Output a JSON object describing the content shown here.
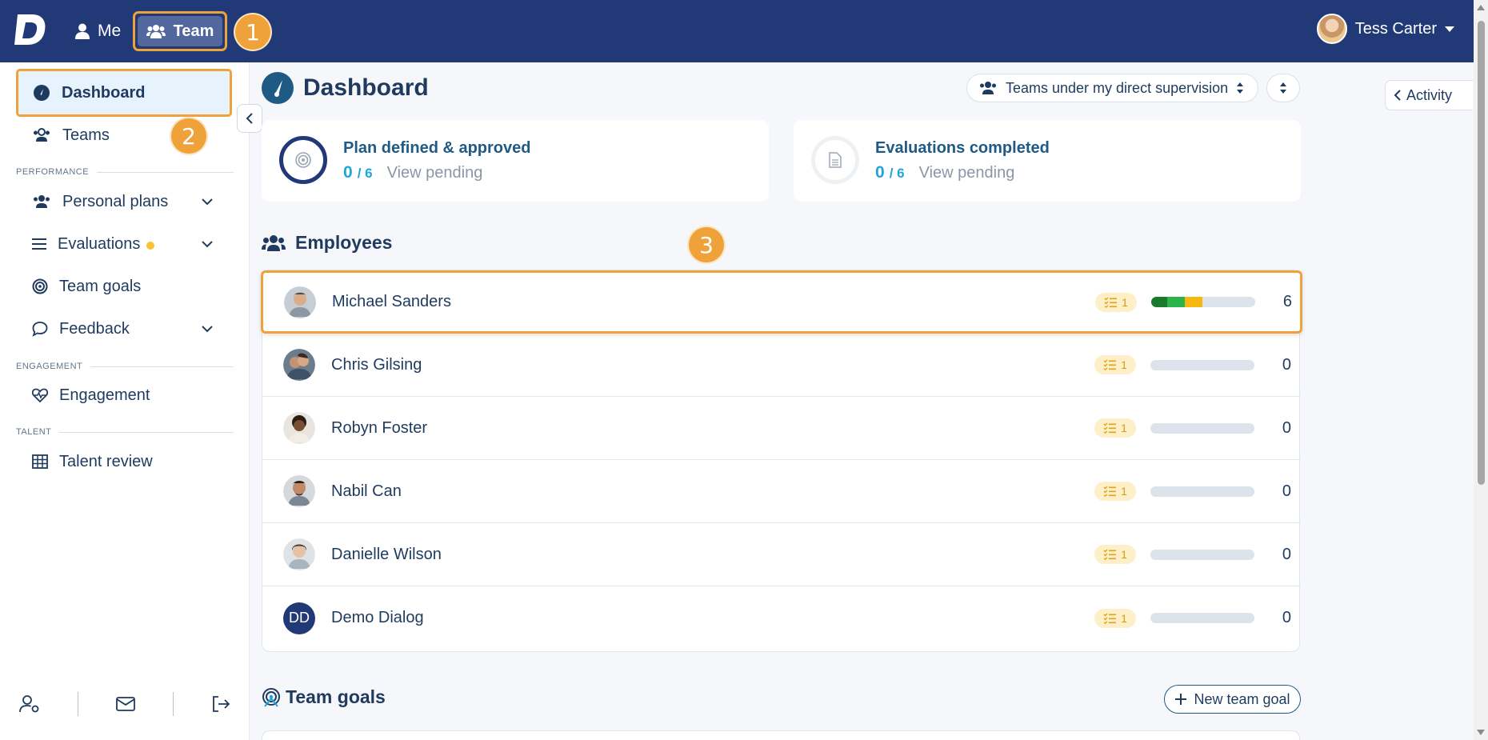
{
  "topbar": {
    "brand": "D",
    "nav_me": "Me",
    "nav_team": "Team",
    "user_name": "Tess Carter"
  },
  "step_badges": [
    "1",
    "2",
    "3"
  ],
  "sidebar": {
    "dashboard": "Dashboard",
    "teams": "Teams",
    "section_performance": "PERFORMANCE",
    "personal_plans": "Personal plans",
    "evaluations": "Evaluations",
    "team_goals": "Team goals",
    "feedback": "Feedback",
    "section_engagement": "ENGAGEMENT",
    "engagement": "Engagement",
    "section_talent": "TALENT",
    "talent_review": "Talent review"
  },
  "main": {
    "title": "Dashboard",
    "scope_select": "Teams under my direct supervision",
    "activity": "Activity",
    "cards": [
      {
        "title": "Plan defined & approved",
        "done": "0",
        "total": "/ 6",
        "link": "View pending"
      },
      {
        "title": "Evaluations completed",
        "done": "0",
        "total": "/ 6",
        "link": "View pending"
      }
    ],
    "employees_title": "Employees",
    "employees": [
      {
        "name": "Michael Sanders",
        "tasks": "1",
        "count": "6",
        "progress": [
          {
            "color": "#1a7a2c",
            "fraction": 0.15
          },
          {
            "color": "#2bb44a",
            "fraction": 0.17
          },
          {
            "color": "#f5b80f",
            "fraction": 0.17
          }
        ]
      },
      {
        "name": "Chris Gilsing",
        "tasks": "1",
        "count": "0"
      },
      {
        "name": "Robyn Foster",
        "tasks": "1",
        "count": "0"
      },
      {
        "name": "Nabil Can",
        "tasks": "1",
        "count": "0"
      },
      {
        "name": "Danielle Wilson",
        "tasks": "1",
        "count": "0"
      },
      {
        "name": "Demo Dialog",
        "initials": "DD",
        "tasks": "1",
        "count": "0"
      }
    ],
    "team_goals_title": "Team goals",
    "new_team_goal": "New team goal"
  },
  "colors": {
    "topbar": "#213a77",
    "highlight": "#f0a23a",
    "accent": "#1fa6d8",
    "text": "#1f3a5f"
  }
}
